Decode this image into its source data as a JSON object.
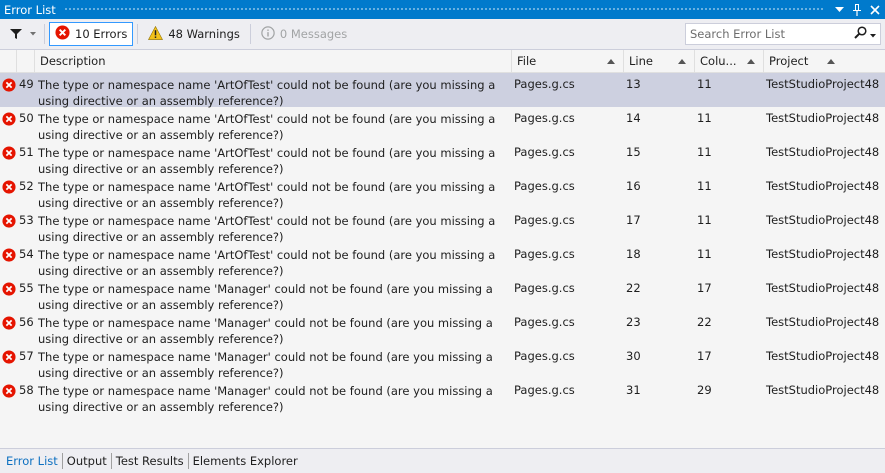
{
  "window": {
    "title": "Error List"
  },
  "toolbar": {
    "errors_label": "10 Errors",
    "warnings_label": "48 Warnings",
    "messages_label": "0 Messages",
    "search_placeholder": "Search Error List"
  },
  "columns": {
    "description": "Description",
    "file": "File",
    "line": "Line",
    "column": "Colu...",
    "project": "Project"
  },
  "rows": [
    {
      "num": "49",
      "desc": "The type or namespace name 'ArtOfTest' could not be found (are you missing a using directive or an assembly reference?)",
      "file": "Pages.g.cs",
      "line": "13",
      "col": "11",
      "project": "TestStudioProject48",
      "selected": true
    },
    {
      "num": "50",
      "desc": "The type or namespace name 'ArtOfTest' could not be found (are you missing a using directive or an assembly reference?)",
      "file": "Pages.g.cs",
      "line": "14",
      "col": "11",
      "project": "TestStudioProject48"
    },
    {
      "num": "51",
      "desc": "The type or namespace name 'ArtOfTest' could not be found (are you missing a using directive or an assembly reference?)",
      "file": "Pages.g.cs",
      "line": "15",
      "col": "11",
      "project": "TestStudioProject48"
    },
    {
      "num": "52",
      "desc": "The type or namespace name 'ArtOfTest' could not be found (are you missing a using directive or an assembly reference?)",
      "file": "Pages.g.cs",
      "line": "16",
      "col": "11",
      "project": "TestStudioProject48"
    },
    {
      "num": "53",
      "desc": "The type or namespace name 'ArtOfTest' could not be found (are you missing a using directive or an assembly reference?)",
      "file": "Pages.g.cs",
      "line": "17",
      "col": "11",
      "project": "TestStudioProject48"
    },
    {
      "num": "54",
      "desc": "The type or namespace name 'ArtOfTest' could not be found (are you missing a using directive or an assembly reference?)",
      "file": "Pages.g.cs",
      "line": "18",
      "col": "11",
      "project": "TestStudioProject48"
    },
    {
      "num": "55",
      "desc": "The type or namespace name 'Manager' could not be found (are you missing a using directive or an assembly reference?)",
      "file": "Pages.g.cs",
      "line": "22",
      "col": "17",
      "project": "TestStudioProject48"
    },
    {
      "num": "56",
      "desc": "The type or namespace name 'Manager' could not be found (are you missing a using directive or an assembly reference?)",
      "file": "Pages.g.cs",
      "line": "23",
      "col": "22",
      "project": "TestStudioProject48"
    },
    {
      "num": "57",
      "desc": "The type or namespace name 'Manager' could not be found (are you missing a using directive or an assembly reference?)",
      "file": "Pages.g.cs",
      "line": "30",
      "col": "17",
      "project": "TestStudioProject48"
    },
    {
      "num": "58",
      "desc": "The type or namespace name 'Manager' could not be found (are you missing a using directive or an assembly reference?)",
      "file": "Pages.g.cs",
      "line": "31",
      "col": "29",
      "project": "TestStudioProject48"
    }
  ],
  "bottom_tabs": [
    {
      "label": "Error List",
      "active": true
    },
    {
      "label": "Output"
    },
    {
      "label": "Test Results"
    },
    {
      "label": "Elements Explorer"
    }
  ],
  "icons": {
    "titlebar": [
      "dropdown-arrow-icon",
      "pin-icon",
      "close-icon"
    ],
    "toolbar": [
      "filter-icon",
      "error-icon",
      "warning-icon",
      "info-icon",
      "search-icon"
    ]
  },
  "colors": {
    "accent": "#007acc",
    "error": "#e51400",
    "warning": "#f3c21a",
    "selected_row": "#cdd0e0",
    "active_tab": "#0e70c0"
  }
}
